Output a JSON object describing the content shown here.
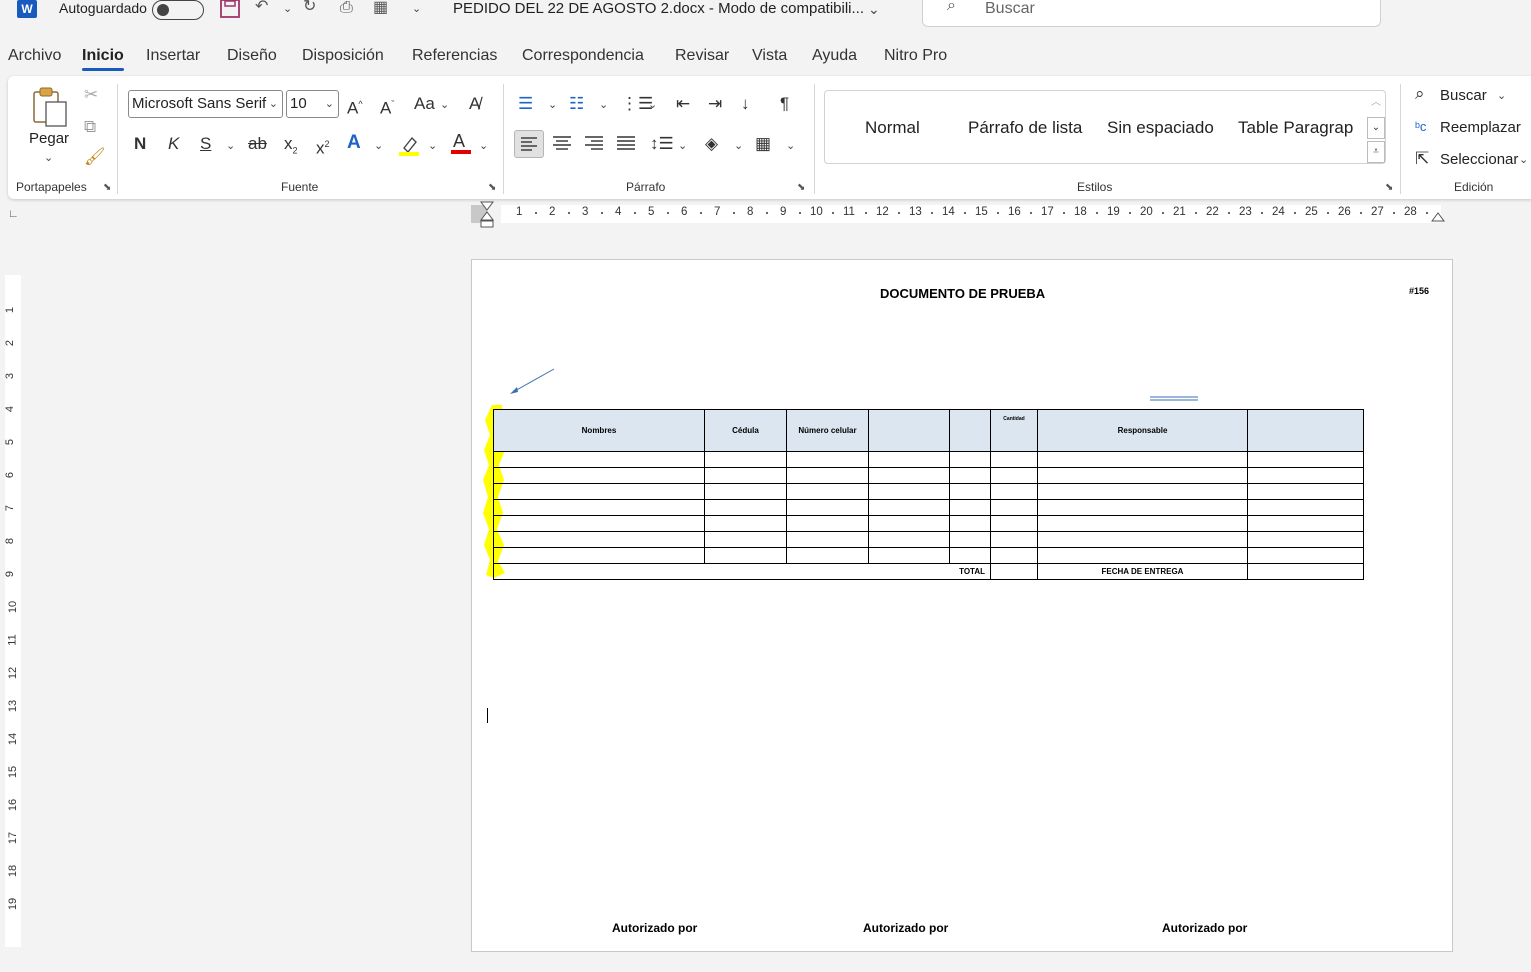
{
  "titlebar": {
    "autosave_label": "Autoguardado",
    "document_title": "PEDIDO DEL 22 DE AGOSTO 2.docx  -  Modo de compatibili...",
    "search_placeholder": "Buscar"
  },
  "tabs": [
    "Archivo",
    "Inicio",
    "Insertar",
    "Diseño",
    "Disposición",
    "Referencias",
    "Correspondencia",
    "Revisar",
    "Vista",
    "Ayuda",
    "Nitro Pro"
  ],
  "active_tab": "Inicio",
  "ribbon": {
    "clipboard": {
      "paste_label": "Pegar",
      "group_label": "Portapapeles"
    },
    "font": {
      "font_name": "Microsoft Sans Serif",
      "font_size": "10",
      "bold": "N",
      "italic": "K",
      "underline": "S",
      "strike": "ab",
      "change_case": "Aa",
      "group_label": "Fuente"
    },
    "paragraph": {
      "group_label": "Párrafo"
    },
    "styles": {
      "items": [
        "Normal",
        "Párrafo de lista",
        "Sin espaciado",
        "Table Paragrap"
      ],
      "group_label": "Estilos"
    },
    "editing": {
      "find": "Buscar",
      "replace": "Reemplazar",
      "select": "Seleccionar",
      "group_label": "Edición"
    }
  },
  "ruler": {
    "h_numbers": [
      "1",
      "2",
      "3",
      "4",
      "5",
      "6",
      "7",
      "8",
      "9",
      "10",
      "11",
      "12",
      "13",
      "14",
      "15",
      "16",
      "17",
      "18",
      "19",
      "20",
      "21",
      "22",
      "23",
      "24",
      "25",
      "26",
      "27",
      "28"
    ],
    "v_numbers": [
      "1",
      "2",
      "3",
      "4",
      "5",
      "6",
      "7",
      "8",
      "9",
      "10",
      "11",
      "12",
      "13",
      "14",
      "15",
      "16",
      "17",
      "18",
      "19"
    ]
  },
  "document": {
    "title": "DOCUMENTO DE PRUEBA",
    "number": "#156",
    "table": {
      "headers": [
        "Nombres",
        "Cédula",
        "Número celular",
        "",
        "",
        "Cantidad",
        "Responsable",
        ""
      ],
      "empty_rows": 7,
      "total_label": "TOTAL",
      "delivery_label": "FECHA DE ENTREGA"
    },
    "signatures": [
      "Autorizado por",
      "Autorizado por",
      "Autorizado por"
    ]
  },
  "colors": {
    "accent": "#185abd",
    "header_fill": "#dce6f1",
    "highlight": "#ffff00",
    "font_color": "#e00000"
  }
}
